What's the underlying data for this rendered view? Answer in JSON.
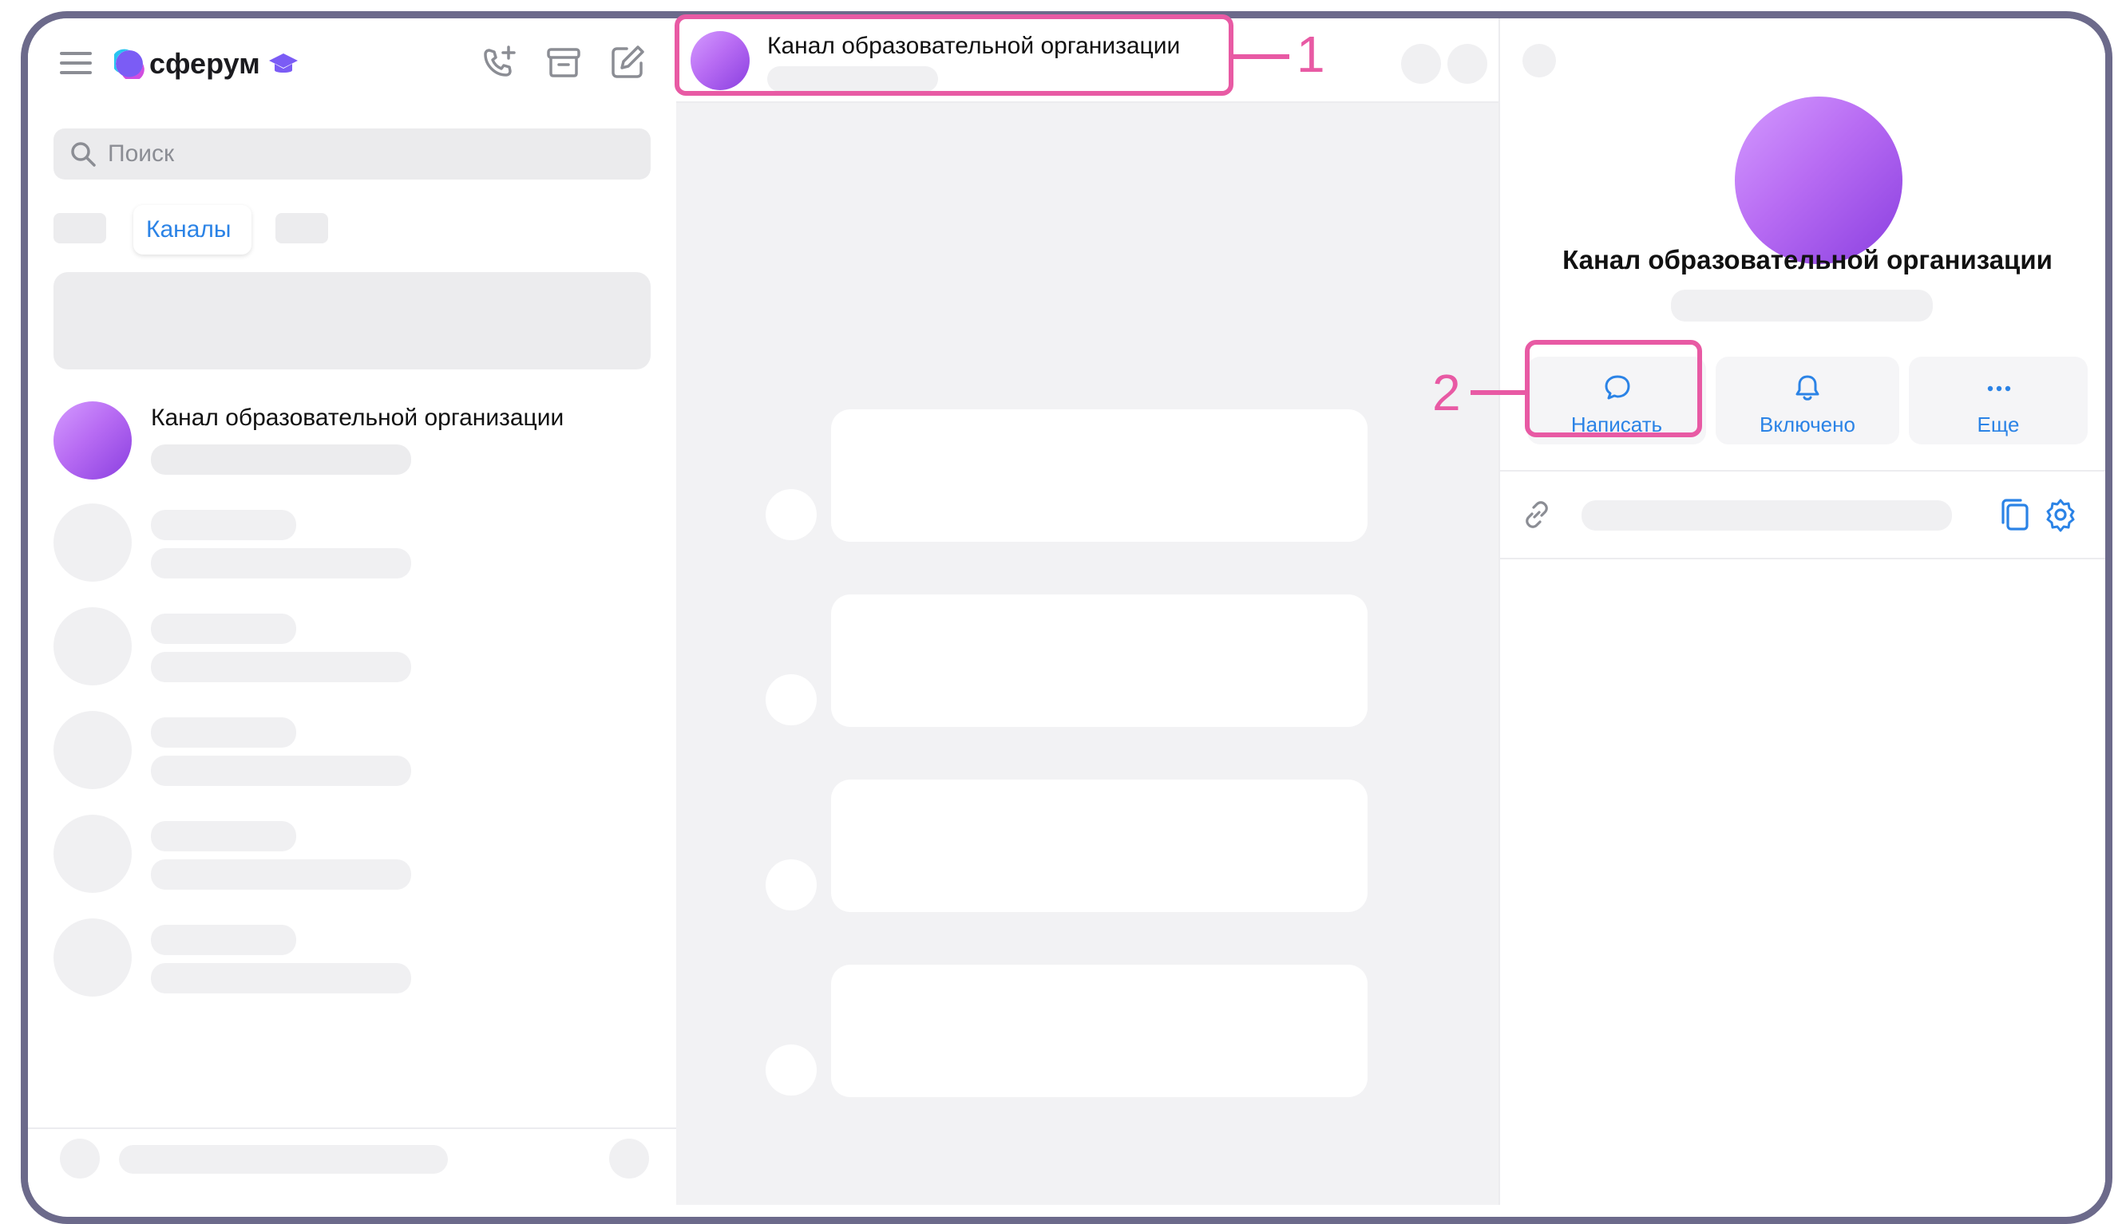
{
  "app": {
    "brand": "сферум"
  },
  "sidebar": {
    "search_placeholder": "Поиск",
    "active_tab": "Каналы",
    "channel_name": "Канал образовательной организации"
  },
  "chat_header": {
    "title": "Канал образовательной организации"
  },
  "profile": {
    "title": "Канал образовательной организации",
    "actions": [
      {
        "label": "Написать",
        "icon": "message-icon"
      },
      {
        "label": "Включено",
        "icon": "bell-icon"
      },
      {
        "label": "Еще",
        "icon": "more-icon"
      }
    ]
  },
  "callouts": {
    "one": "1",
    "two": "2"
  },
  "colors": {
    "accent": "#2b83e6",
    "callout": "#e85aa4",
    "frame": "#6c6a8b"
  }
}
